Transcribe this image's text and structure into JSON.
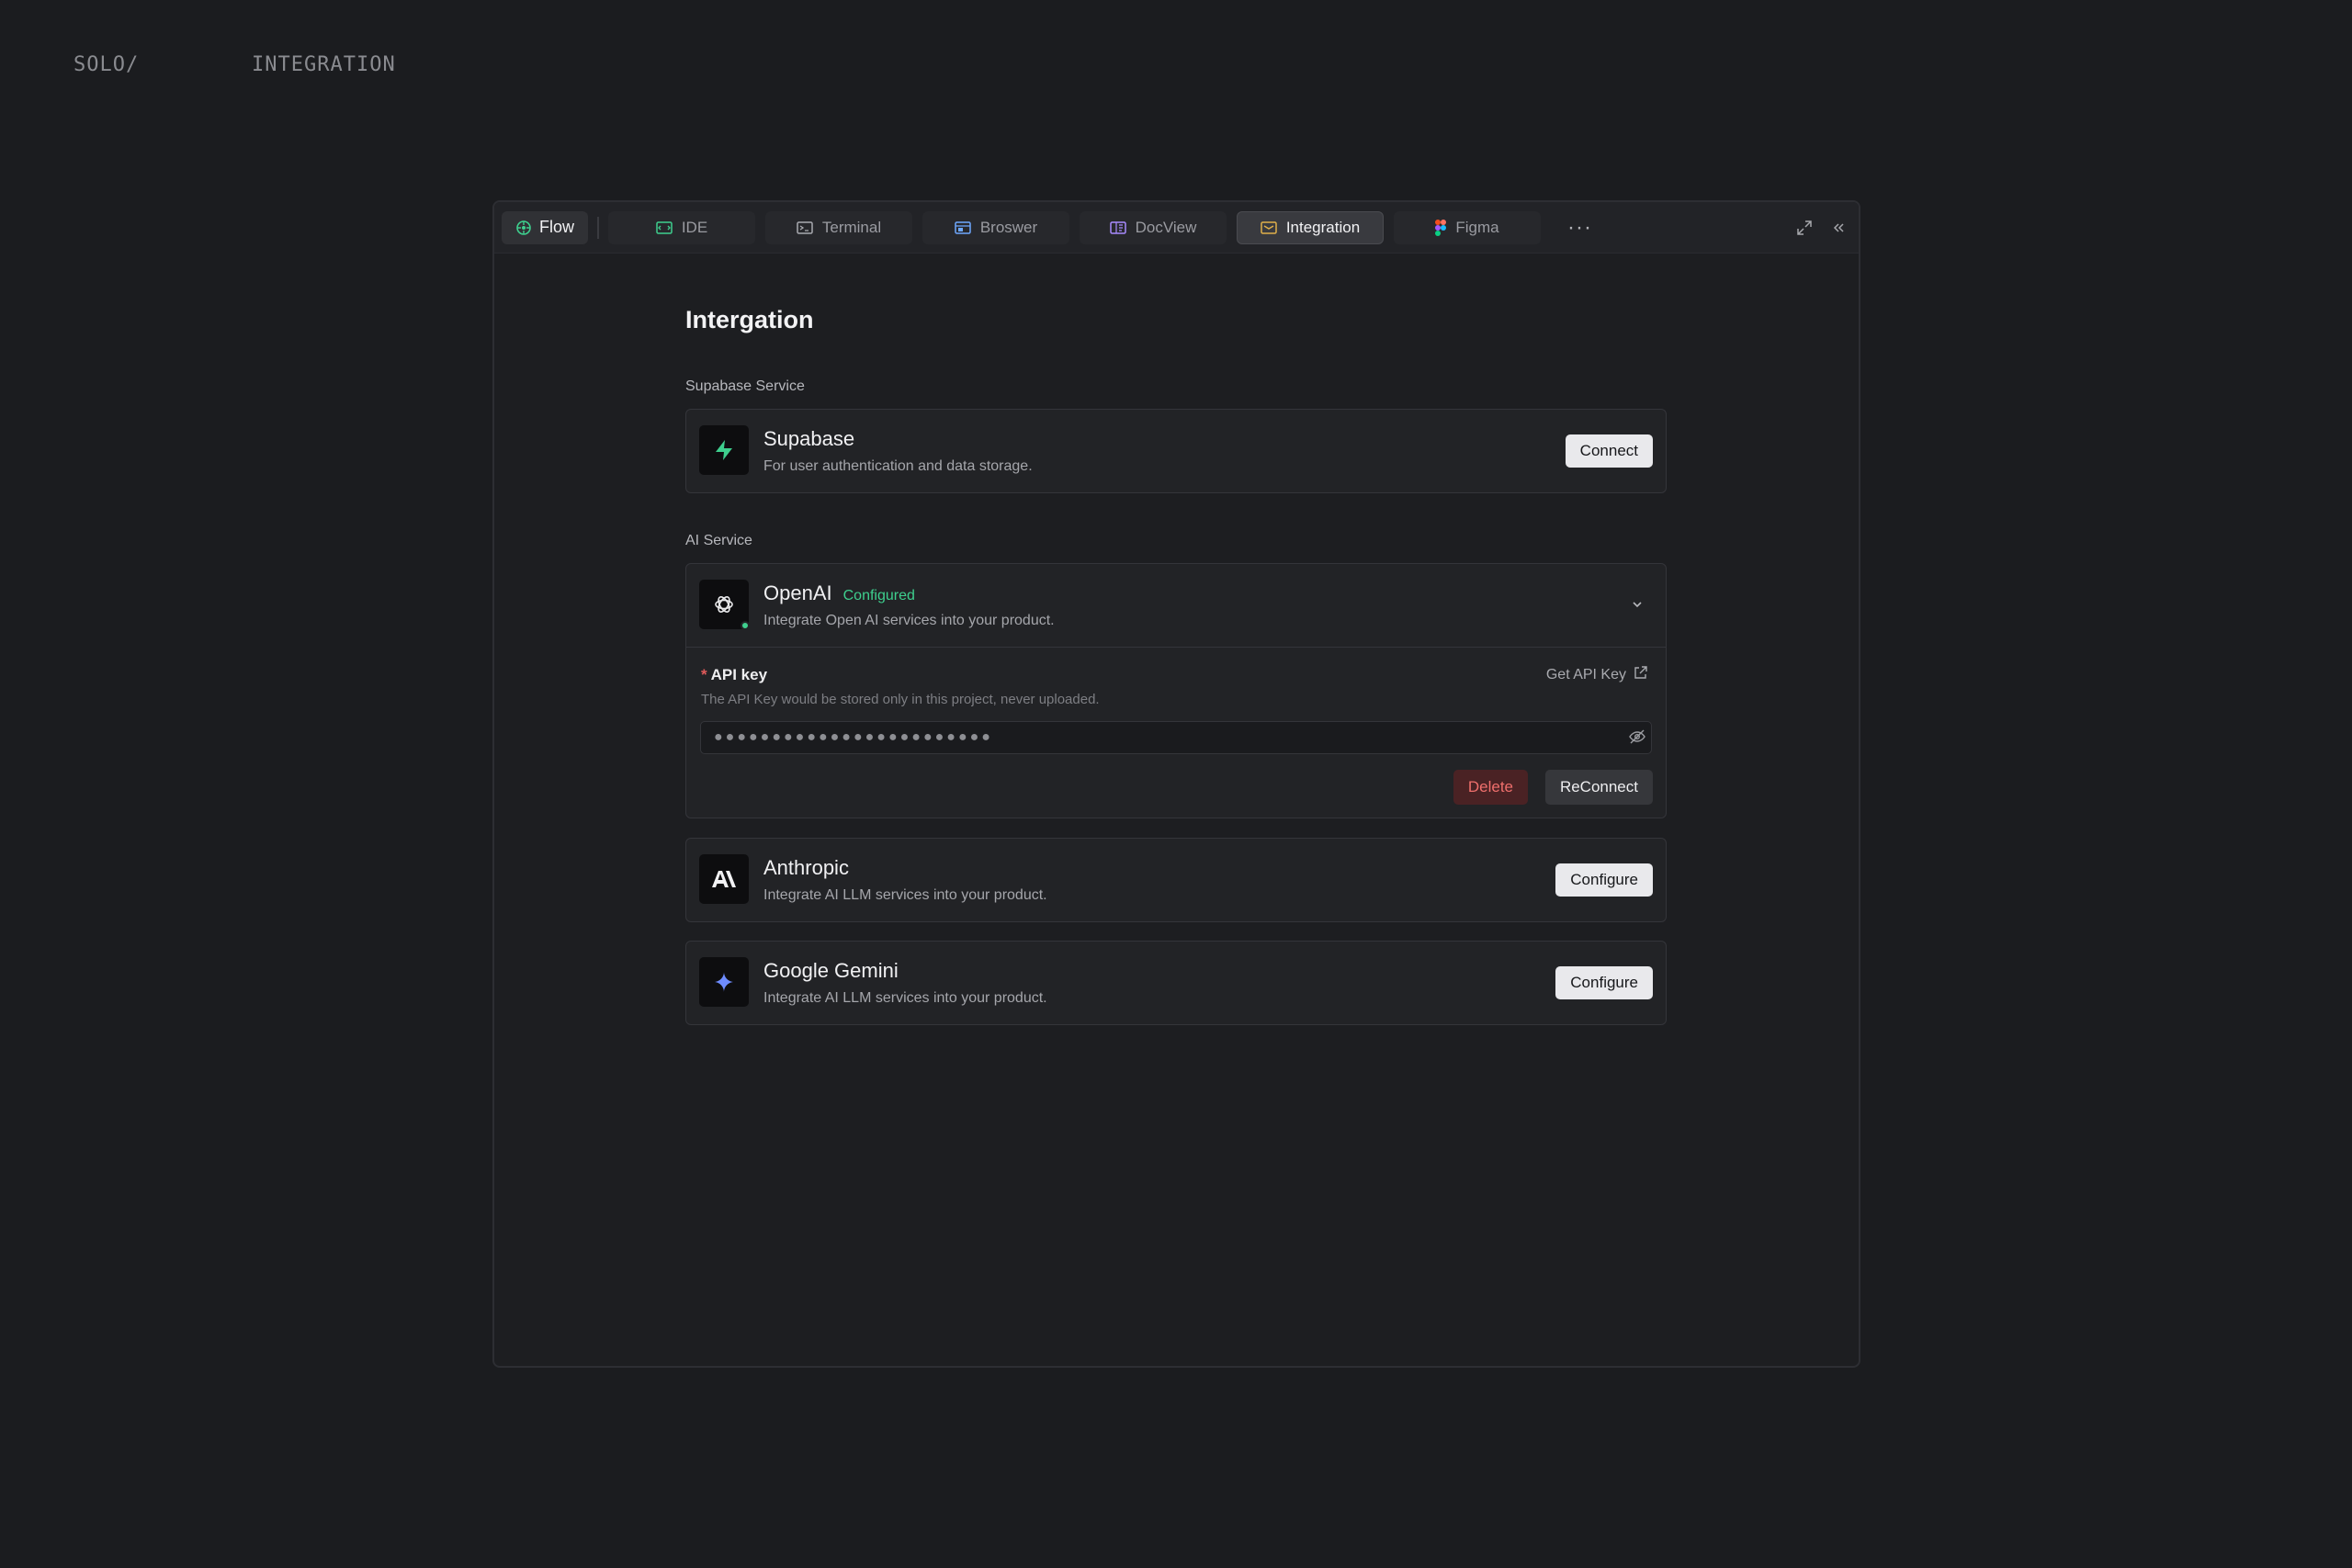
{
  "page_header": {
    "prefix": "SOLO/",
    "section": "INTEGRATION"
  },
  "tabs": {
    "flow": "Flow",
    "ide": "IDE",
    "terminal": "Terminal",
    "browser": "Broswer",
    "docview": "DocView",
    "integration": "Integration",
    "figma": "Figma",
    "more": "···",
    "active": "Integration"
  },
  "main": {
    "title": "Intergation",
    "supabase_section": "Supabase Service",
    "ai_section": "AI Service"
  },
  "supabase": {
    "name": "Supabase",
    "description": "For user authentication and data storage.",
    "button": "Connect"
  },
  "openai": {
    "name": "OpenAI",
    "status": "Configured",
    "description": "Integrate Open AI services into your product.",
    "api_key_label": "API key",
    "required_mark": "*",
    "get_key_label": "Get API Key",
    "help": "The API Key would be stored only in this project, never uploaded.",
    "api_key_value": "●●●●●●●●●●●●●●●●●●●●●●●●",
    "delete_label": "Delete",
    "reconnect_label": "ReConnect"
  },
  "anthropic": {
    "name": "Anthropic",
    "description": "Integrate AI LLM services into your product.",
    "button": "Configure"
  },
  "gemini": {
    "name": "Google Gemini",
    "description": "Integrate AI LLM services into your product.",
    "button": "Configure"
  },
  "colors": {
    "background": "#1b1c1f",
    "accent_green": "#3ecf8e",
    "danger": "#ef6f6c",
    "active_tab_icon": "#e0b04a"
  },
  "icons": {
    "flow": "flow-icon",
    "ide": "ide-icon",
    "terminal": "terminal-icon",
    "browser": "browser-icon",
    "docview": "docview-icon",
    "integration": "integration-icon",
    "figma": "figma-icon",
    "expand": "expand-icon",
    "collapse": "collapse-panel-icon"
  }
}
